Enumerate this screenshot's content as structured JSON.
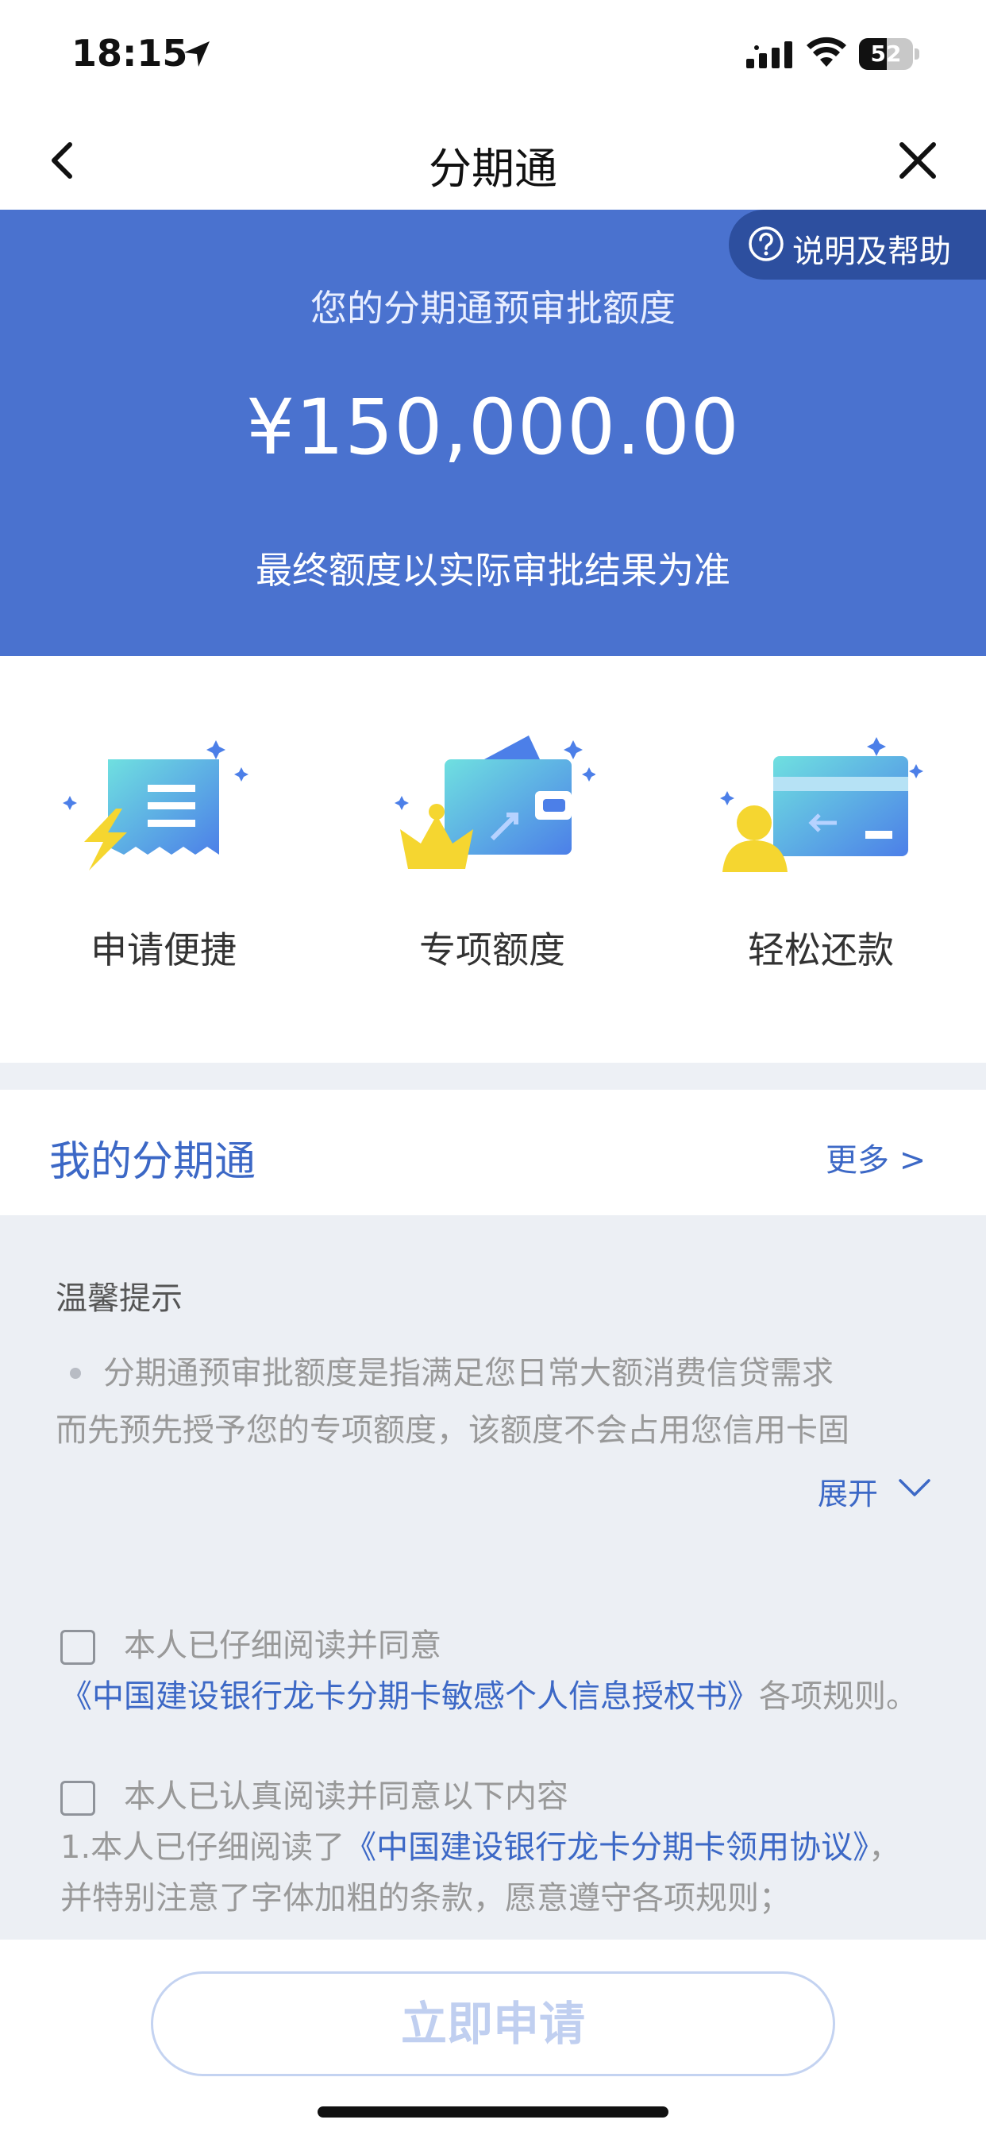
{
  "status_bar": {
    "time": "18:15",
    "battery": "52",
    "battery_level": 0.52,
    "icons": [
      "location-arrow-icon",
      "cellular-signal-icon",
      "wifi-icon",
      "battery-icon"
    ]
  },
  "nav": {
    "title": "分期通",
    "back_icon": "chevron-left-icon",
    "close_icon": "close-icon"
  },
  "hero": {
    "help_label": "说明及帮助",
    "help_icon": "question-circle-icon",
    "label": "您的分期通预审批额度",
    "amount": "¥150,000.00",
    "note": "最终额度以实际审批结果为准"
  },
  "features": [
    {
      "label": "申请便捷",
      "icon": "receipt-lightning-icon"
    },
    {
      "label": "专项额度",
      "icon": "wallet-crown-icon"
    },
    {
      "label": "轻松还款",
      "icon": "card-user-icon"
    }
  ],
  "my_section": {
    "title": "我的分期通",
    "more": "更多 >"
  },
  "tips": {
    "title": "温馨提示",
    "line1": "分期通预审批额度是指满足您日常大额消费信贷需求",
    "line2": "而先预先授予您的专项额度，该额度不会占用您信用卡固",
    "expand": "展开"
  },
  "agreements": {
    "first_prefix": "本人已仔细阅读并同意",
    "first_link": "《中国建设银行龙卡分期卡敏感个人信息授权书》",
    "first_suffix": "各项规则。",
    "second_prefix": "本人已认真阅读并同意以下内容",
    "second_item_prefix": "1.本人已仔细阅读了",
    "second_link": "《中国建设银行龙卡分期卡领用协议》",
    "second_item_suffix": "，并特别注意了字体加粗的条款，愿意遵守各项规则；"
  },
  "apply_button": "立即申请",
  "colors": {
    "primary_blue": "#4a72cf",
    "help_pill": "#2d4f9f",
    "link_blue": "#3c68c6",
    "tips_bg": "#eceff4"
  }
}
